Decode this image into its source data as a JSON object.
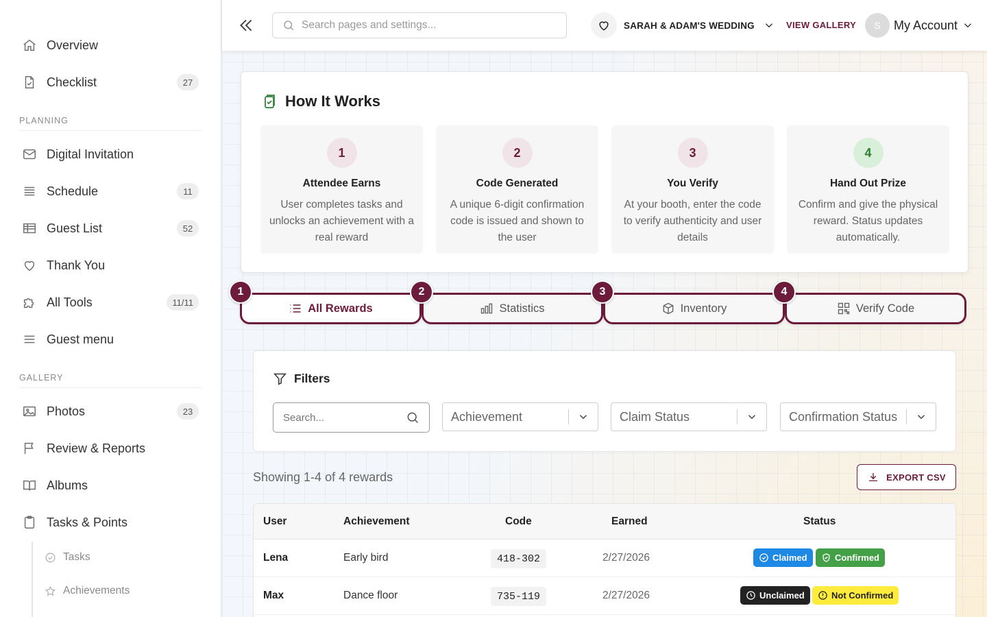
{
  "sidebar": {
    "items": [
      {
        "label": "Overview",
        "icon": "home-icon"
      },
      {
        "label": "Checklist",
        "icon": "checklist-icon",
        "badge": "27"
      },
      {
        "label": "Digital Invitation",
        "icon": "mail-icon"
      },
      {
        "label": "Schedule",
        "icon": "schedule-icon",
        "badge": "11"
      },
      {
        "label": "Guest List",
        "icon": "table-icon",
        "badge": "52"
      },
      {
        "label": "Thank You",
        "icon": "heart-icon"
      },
      {
        "label": "All Tools",
        "icon": "puzzle-icon",
        "badge": "11/11"
      },
      {
        "label": "Guest menu",
        "icon": "menu-icon"
      },
      {
        "label": "Photos",
        "icon": "image-icon",
        "badge": "23"
      },
      {
        "label": "Review & Reports",
        "icon": "flag-icon"
      },
      {
        "label": "Albums",
        "icon": "book-icon"
      },
      {
        "label": "Tasks & Points",
        "icon": "clipboard-icon"
      }
    ],
    "sections": {
      "planning": "PLANNING",
      "gallery": "GALLERY"
    },
    "subitems": [
      {
        "label": "Tasks",
        "icon": "check-circle-icon"
      },
      {
        "label": "Achievements",
        "icon": "star-icon"
      }
    ]
  },
  "topbar": {
    "search_placeholder": "Search pages and settings...",
    "event_name": "SARAH & ADAM'S WEDDING",
    "view_gallery": "VIEW GALLERY",
    "avatar_initial": "S",
    "account_label": "My Account"
  },
  "how_it_works": {
    "title": "How It Works",
    "steps": [
      {
        "num": "1",
        "title": "Attendee Earns",
        "desc": "User completes tasks and unlocks an achievement with a real reward",
        "color": "#6d1b3b",
        "bg": "#f0e4e8"
      },
      {
        "num": "2",
        "title": "Code Generated",
        "desc": "A unique 6-digit confirmation code is issued and shown to the user",
        "color": "#6d1b3b",
        "bg": "#f0e4e8"
      },
      {
        "num": "3",
        "title": "You Verify",
        "desc": "At your booth, enter the code to verify authenticity and user details",
        "color": "#6d1b3b",
        "bg": "#f0e4e8"
      },
      {
        "num": "4",
        "title": "Hand Out Prize",
        "desc": "Confirm and give the physical reward. Status updates automatically.",
        "color": "#2e7d32",
        "bg": "#d8efd9"
      }
    ]
  },
  "tabs": [
    {
      "num": "1",
      "label": "All Rewards",
      "icon": "list-icon",
      "active": true
    },
    {
      "num": "2",
      "label": "Statistics",
      "icon": "bar-chart-icon",
      "active": false
    },
    {
      "num": "3",
      "label": "Inventory",
      "icon": "box-icon",
      "active": false
    },
    {
      "num": "4",
      "label": "Verify Code",
      "icon": "qr-code-icon",
      "active": false
    }
  ],
  "filters": {
    "title": "Filters",
    "search_placeholder": "Search...",
    "selects": [
      "Achievement",
      "Claim Status",
      "Confirmation Status"
    ]
  },
  "results": {
    "showing": "Showing 1-4 of 4 rewards",
    "export_label": "EXPORT CSV"
  },
  "table": {
    "columns": [
      "User",
      "Achievement",
      "Code",
      "Earned",
      "Status"
    ],
    "rows": [
      {
        "user": "Lena",
        "achievement": "Early bird",
        "code": "418-302",
        "earned": "2/27/2026",
        "claim": "Claimed",
        "confirm": "Confirmed"
      },
      {
        "user": "Max",
        "achievement": "Dance floor",
        "code": "735-119",
        "earned": "2/27/2026",
        "claim": "Unclaimed",
        "confirm": "Not Confirmed"
      }
    ]
  },
  "colors": {
    "accent": "#6d1b3b",
    "success": "#43a047",
    "info": "#1e88e5",
    "warning": "#ffeb3b"
  }
}
